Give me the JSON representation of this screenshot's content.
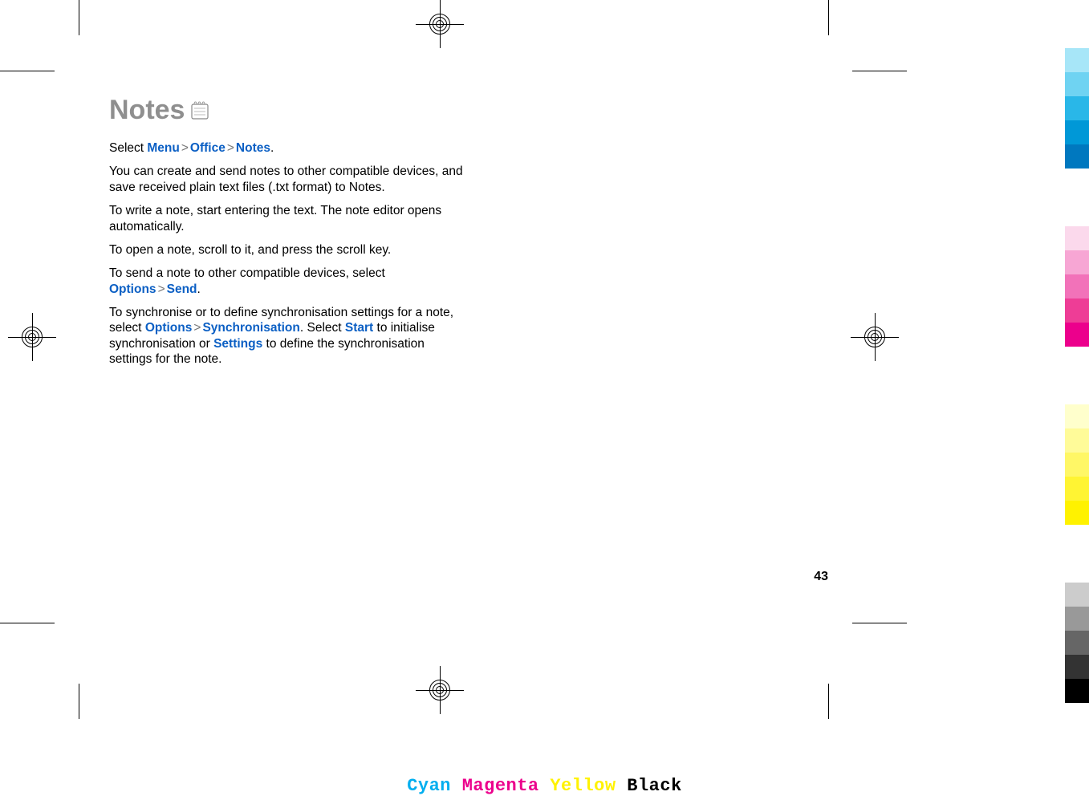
{
  "title": "Notes",
  "page_number": "43",
  "paragraphs": {
    "p1_a": "Select ",
    "p1_menu": "Menu",
    "p1_office": "Office",
    "p1_notes": "Notes",
    "p1_dot": ".",
    "p2": "You can create and send notes to other compatible devices, and save received plain text files (.txt format) to Notes.",
    "p3": "To write a note, start entering the text. The note editor opens automatically.",
    "p4": "To open a note, scroll to it, and press the scroll key.",
    "p5_a": "To send a note to other compatible devices, select ",
    "p5_options": "Options",
    "p5_send": "Send",
    "p5_dot": ".",
    "p6_a": "To synchronise or to define synchronisation settings for a note, select ",
    "p6_options": "Options",
    "p6_sync": "Synchronisation",
    "p6_b": ". Select ",
    "p6_start": "Start",
    "p6_c": " to initialise synchronisation or ",
    "p6_settings": "Settings",
    "p6_d": " to define the synchronisation settings for the note."
  },
  "separator": ">",
  "cmyk": {
    "cyan": "Cyan",
    "magenta": "Magenta",
    "yellow": "Yellow",
    "black": "Black"
  },
  "colorbar": [
    "#a7e6f8",
    "#6fd3f2",
    "#29b7e8",
    "#0098d7",
    "#0078bf",
    "gap",
    "#fbd9ec",
    "#f7a6d4",
    "#f272b9",
    "#ee3d96",
    "#ec008c",
    "gap",
    "#ffffcc",
    "#fffb99",
    "#fff766",
    "#fff433",
    "#fff200",
    "gap",
    "#cccccc",
    "#999999",
    "#666666",
    "#333333",
    "#000000"
  ]
}
